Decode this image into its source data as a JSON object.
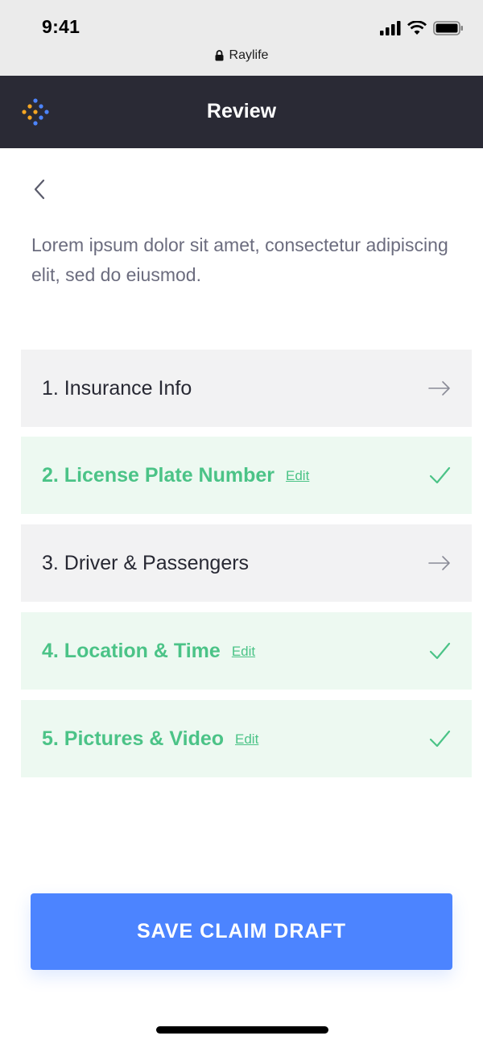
{
  "status_bar": {
    "time": "9:41",
    "url": "Raylife"
  },
  "header": {
    "title": "Review"
  },
  "intro": {
    "text": "Lorem ipsum dolor sit amet, consectetur adipiscing elit, sed do eiusmod."
  },
  "steps": [
    {
      "label": "1. Insurance Info",
      "status": "pending"
    },
    {
      "label": "2. License Plate Number",
      "status": "done",
      "edit_label": "Edit"
    },
    {
      "label": "3. Driver & Passengers",
      "status": "pending"
    },
    {
      "label": "4. Location & Time",
      "status": "done",
      "edit_label": "Edit"
    },
    {
      "label": "5. Pictures & Video",
      "status": "done",
      "edit_label": "Edit"
    }
  ],
  "actions": {
    "save_label": "SAVE CLAIM DRAFT"
  },
  "colors": {
    "header_bg": "#2a2a35",
    "pending_bg": "#f2f2f3",
    "done_bg": "#edf9f1",
    "success": "#4bc387",
    "primary": "#4c84ff"
  },
  "icons": {
    "back": "chevron-left-icon",
    "pending": "arrow-right-icon",
    "done": "check-icon"
  }
}
